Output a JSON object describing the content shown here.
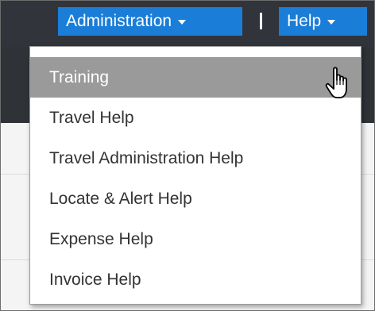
{
  "header": {
    "admin_label": "Administration",
    "help_label": "Help",
    "divider": "|"
  },
  "help_menu": {
    "items": [
      {
        "label": "Training",
        "highlighted": true
      },
      {
        "label": "Travel Help",
        "highlighted": false
      },
      {
        "label": "Travel Administration Help",
        "highlighted": false
      },
      {
        "label": "Locate & Alert Help",
        "highlighted": false
      },
      {
        "label": "Expense Help",
        "highlighted": false
      },
      {
        "label": "Invoice Help",
        "highlighted": false
      }
    ]
  },
  "colors": {
    "header_bg": "#31353b",
    "button_blue": "#1a7dd7",
    "highlight_gray": "#9a9a9a",
    "menu_text": "#333333"
  },
  "icons": {
    "cursor": "hand-pointer-icon",
    "dropdown_caret": "caret-down-icon"
  }
}
